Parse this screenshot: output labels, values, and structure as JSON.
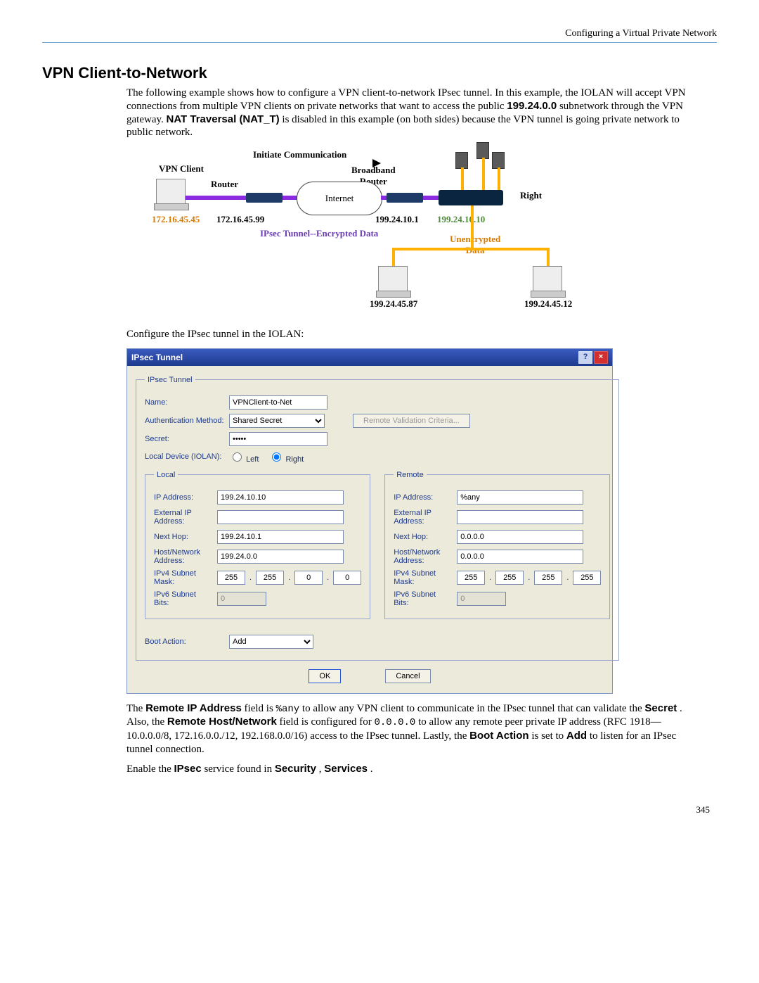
{
  "header": {
    "right": "Configuring a Virtual Private Network"
  },
  "section_title": "VPN Client-to-Network",
  "intro": {
    "p1a": "The following example shows how to configure a VPN client-to-network IPsec tunnel. In this example, the IOLAN will accept VPN connections from multiple VPN clients on private networks that want to access the public ",
    "p1b_bold": "199.24.0.0",
    "p1c": " subnetwork through the VPN gateway. ",
    "p1d_bold": "NAT Traversal (NAT_T)",
    "p1e": " is disabled in this example (on both sides) because the VPN tunnel is going private network to public network."
  },
  "diagram": {
    "initiate": "Initiate Communication",
    "vpn_client": "VPN Client",
    "router": "Router",
    "broadband_router": "Broadband\nRouter",
    "internet": "Internet",
    "right": "Right",
    "ipsec_label": "IPsec Tunnel--Encrypted Data",
    "unenc": "Unencrypted\nData",
    "ip_client": "172.16.45.45",
    "ip_router1": "172.16.45.99",
    "ip_router2": "199.24.10.1",
    "ip_gateway": "199.24.10.10",
    "ip_pc1": "199.24.45.87",
    "ip_pc2": "199.24.45.12"
  },
  "caption1": "Configure the IPsec tunnel in the IOLAN:",
  "dialog": {
    "title": "IPsec Tunnel",
    "fs_main": "IPsec Tunnel",
    "lbl_name": "Name:",
    "val_name": "VPNClient-to-Net",
    "lbl_auth": "Authentication Method:",
    "val_auth": "Shared Secret",
    "btn_remote_valid": "Remote Validation Criteria...",
    "lbl_secret": "Secret:",
    "val_secret": "•••••",
    "lbl_localdev": "Local Device (IOLAN):",
    "radio_left": "Left",
    "radio_right": "Right",
    "fs_local": "Local",
    "fs_remote": "Remote",
    "lbl_ip": "IP Address:",
    "lbl_extip": "External IP\nAddress:",
    "lbl_nexthop": "Next Hop:",
    "lbl_hostnet": "Host/Network\nAddress:",
    "lbl_v4mask": "IPv4 Subnet\nMask:",
    "lbl_v6bits": "IPv6 Subnet\nBits:",
    "local": {
      "ip": "199.24.10.10",
      "extip": "",
      "nexthop": "199.24.10.1",
      "hostnet": "199.24.0.0",
      "mask": [
        "255",
        "255",
        "0",
        "0"
      ],
      "v6bits": "0"
    },
    "remote": {
      "ip": "%any",
      "extip": "",
      "nexthop": "0.0.0.0",
      "hostnet": "0.0.0.0",
      "mask": [
        "255",
        "255",
        "255",
        "255"
      ],
      "v6bits": "0"
    },
    "lbl_boot": "Boot Action:",
    "val_boot": "Add",
    "btn_ok": "OK",
    "btn_cancel": "Cancel"
  },
  "outro": {
    "a": "The ",
    "b_bold": "Remote IP Address",
    "c": " field is ",
    "d_code": "%any",
    "e": " to allow any VPN client to communicate in the IPsec tunnel that can validate the ",
    "f_bold": "Secret",
    "g": ". Also, the ",
    "h_bold": "Remote Host/Network",
    "i": " field is configured for ",
    "j_code": "0.0.0.0",
    "k": " to allow any remote peer private IP address (RFC 1918—10.0.0.0/8, 172.16.0.0./12, 192.168.0.0/16) access to the IPsec tunnel. Lastly, the ",
    "l_bold": "Boot Action",
    "m": " is set to ",
    "n_bold": "Add",
    "o": " to listen for an IPsec tunnel connection."
  },
  "enable": {
    "a": "Enable the ",
    "b_bold": "IPsec",
    "c": " service found in ",
    "d_bold": "Security",
    "e": ", ",
    "f_bold": "Services",
    "g": "."
  },
  "page_number": "345"
}
